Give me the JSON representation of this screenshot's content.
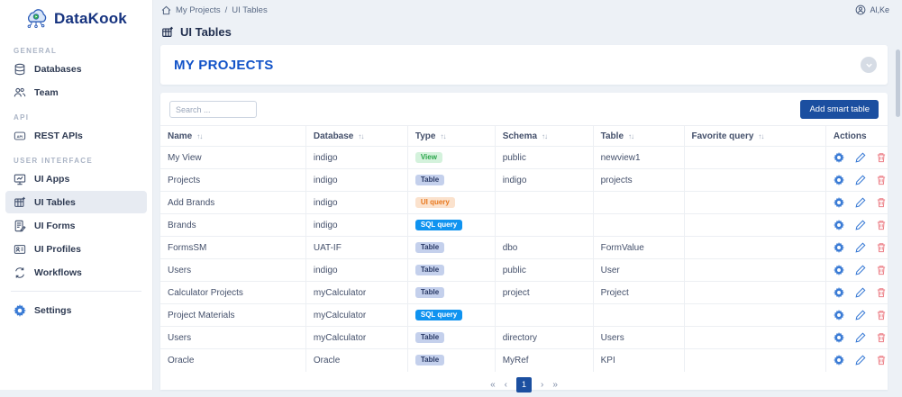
{
  "app": {
    "name": "DataKook",
    "user": "Al,Ke"
  },
  "breadcrumb": {
    "items": [
      "My Projects",
      "UI Tables"
    ],
    "separator": "/"
  },
  "page": {
    "title": "UI Tables"
  },
  "banner": {
    "title": "MY PROJECTS"
  },
  "sidebar": {
    "sections": [
      {
        "label": "GENERAL",
        "items": [
          {
            "label": "Databases"
          },
          {
            "label": "Team"
          }
        ]
      },
      {
        "label": "API",
        "items": [
          {
            "label": "REST APIs"
          }
        ]
      },
      {
        "label": "USER INTERFACE",
        "items": [
          {
            "label": "UI Apps"
          },
          {
            "label": "UI Tables",
            "active": true
          },
          {
            "label": "UI Forms"
          },
          {
            "label": "UI Profiles"
          },
          {
            "label": "Workflows"
          }
        ]
      }
    ],
    "footer_item": {
      "label": "Settings"
    }
  },
  "toolbar": {
    "search_placeholder": "Search ...",
    "add_button": "Add smart table"
  },
  "table": {
    "sort_icon": "↑↓",
    "columns": [
      {
        "label": "Name",
        "sortable": true
      },
      {
        "label": "Database",
        "sortable": true
      },
      {
        "label": "Type",
        "sortable": true
      },
      {
        "label": "Schema",
        "sortable": true
      },
      {
        "label": "Table",
        "sortable": true
      },
      {
        "label": "Favorite query",
        "sortable": true
      },
      {
        "label": "Actions",
        "sortable": false
      }
    ],
    "rows": [
      {
        "name": "My View",
        "database": "indigo",
        "type": "View",
        "schema": "public",
        "table": "newview1",
        "favorite_query": ""
      },
      {
        "name": "Projects",
        "database": "indigo",
        "type": "Table",
        "schema": "indigo",
        "table": "projects",
        "favorite_query": ""
      },
      {
        "name": "Add Brands",
        "database": "indigo",
        "type": "UI query",
        "schema": "",
        "table": "",
        "favorite_query": ""
      },
      {
        "name": "Brands",
        "database": "indigo",
        "type": "SQL query",
        "schema": "",
        "table": "",
        "favorite_query": ""
      },
      {
        "name": "FormsSM",
        "database": "UAT-IF",
        "type": "Table",
        "schema": "dbo",
        "table": "FormValue",
        "favorite_query": ""
      },
      {
        "name": "Users",
        "database": "indigo",
        "type": "Table",
        "schema": "public",
        "table": "User",
        "favorite_query": ""
      },
      {
        "name": "Calculator Projects",
        "database": "myCalculator",
        "type": "Table",
        "schema": "project",
        "table": "Project",
        "favorite_query": ""
      },
      {
        "name": "Project Materials",
        "database": "myCalculator",
        "type": "SQL query",
        "schema": "",
        "table": "",
        "favorite_query": ""
      },
      {
        "name": "Users",
        "database": "myCalculator",
        "type": "Table",
        "schema": "directory",
        "table": "Users",
        "favorite_query": ""
      },
      {
        "name": "Oracle",
        "database": "Oracle",
        "type": "Table",
        "schema": "MyRef",
        "table": "KPI",
        "favorite_query": ""
      }
    ]
  },
  "badges": {
    "View": {
      "bg": "#d4f2dc",
      "color": "#2aa54a"
    },
    "Table": {
      "bg": "#c4d0ec",
      "color": "#2a3a66"
    },
    "UI query": {
      "bg": "#fbe2cd",
      "color": "#e8781e"
    },
    "SQL query": {
      "bg": "#0f93f0",
      "color": "#ffffff"
    }
  },
  "pagination": {
    "first": "«",
    "prev": "‹",
    "page": "1",
    "next": "›",
    "last": "»"
  },
  "colors": {
    "brand": "#16337f",
    "accent_blue": "#1b4fa0",
    "banner_title": "#1253c8",
    "action_blue": "#3a7bd5",
    "action_red": "#ec7d85",
    "badge_sql": "#0f93f0"
  }
}
